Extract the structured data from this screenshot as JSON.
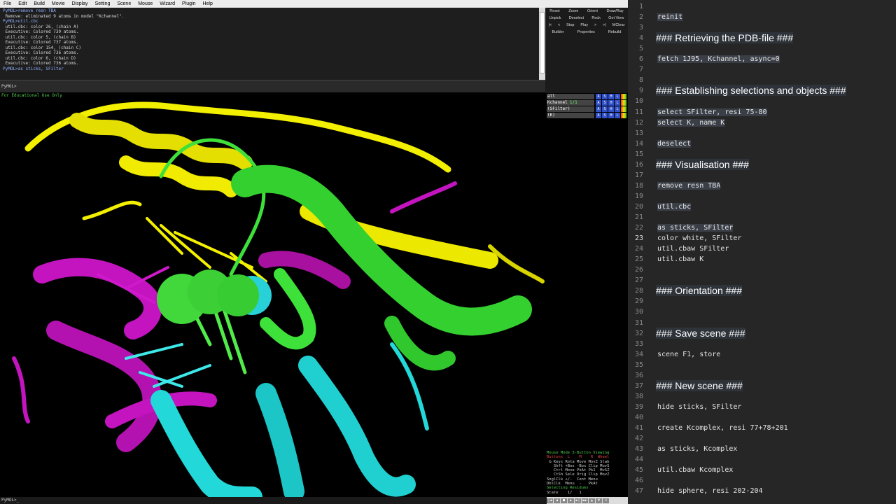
{
  "menu": [
    "File",
    "Edit",
    "Build",
    "Movie",
    "Display",
    "Setting",
    "Scene",
    "Mouse",
    "Wizard",
    "Plugin",
    "Help"
  ],
  "console": {
    "lines": [
      {
        "t": "PyMOL>remove resn TBA",
        "cmd": true
      },
      {
        "t": " Remove: eliminated 9 atoms in model \"Kchannel\".",
        "cmd": false
      },
      {
        "t": "PyMOL>util.cbc",
        "cmd": true
      },
      {
        "t": " util.cbc: color 26, (chain A)",
        "cmd": false
      },
      {
        "t": " Executive: Colored 739 atoms.",
        "cmd": false
      },
      {
        "t": " util.cbc: color 5, (chain B)",
        "cmd": false
      },
      {
        "t": " Executive: Colored 737 atoms.",
        "cmd": false
      },
      {
        "t": " util.cbc: color 154, (chain C)",
        "cmd": false
      },
      {
        "t": " Executive: Colored 736 atoms.",
        "cmd": false
      },
      {
        "t": " util.cbc: color 6, (chain D)",
        "cmd": false
      },
      {
        "t": " Executive: Colored 736 atoms.",
        "cmd": false
      },
      {
        "t": "PyMOL>as sticks, SFilter",
        "cmd": true
      }
    ],
    "prompt": "PyMOL>"
  },
  "buttons": {
    "row1": [
      "Reset",
      "Zoom",
      "Orient",
      "Draw/Ray"
    ],
    "row2": [
      "Unpick",
      "Deselect",
      "Rock",
      "Get View"
    ],
    "row3": [
      "|<",
      "<",
      "Stop",
      "Play",
      ">",
      ">|",
      "MClear"
    ],
    "row4": [
      "Builder",
      "Properties",
      "Rebuild"
    ]
  },
  "viewer": {
    "watermark": "For Educational Use Only"
  },
  "objects": [
    {
      "name": "all",
      "count": ""
    },
    {
      "name": "Kchannel",
      "count": "1/1"
    },
    {
      "name": "(SFilter)",
      "count": ""
    },
    {
      "name": "(K)",
      "count": ""
    }
  ],
  "object_actions": [
    "A",
    "S",
    "H",
    "L"
  ],
  "mouse_panel": [
    "Mouse Mode 3-Button Viewing",
    "Buttons  L    M    R  Wheel",
    " & Keys Rota Move MovZ Slab",
    "   Shft +Box -Box Clip MovS",
    "   Ctrl Move PkAt Pk1  MvSZ",
    "   CtSh Sele Orig Clip MovZ",
    "SnglClk +/-  Cent Menu",
    "DblClk  Menu  -   PkAt",
    "Selecting Residues",
    "State    1/   1"
  ],
  "bottom_prompt": "PyMOL>_",
  "editor": {
    "current_line": 23,
    "lines": [
      {
        "n": 1,
        "text": "",
        "kind": "code"
      },
      {
        "n": 2,
        "text": "reinit",
        "kind": "code"
      },
      {
        "n": 3,
        "text": "",
        "kind": "code"
      },
      {
        "n": 4,
        "text": "### Retrieving the PDB-file ###",
        "kind": "heading"
      },
      {
        "n": 5,
        "text": "",
        "kind": "code"
      },
      {
        "n": 6,
        "text": "fetch 1J95, Kchannel, async=0",
        "kind": "code"
      },
      {
        "n": 7,
        "text": "",
        "kind": "code"
      },
      {
        "n": 8,
        "text": "",
        "kind": "code"
      },
      {
        "n": 9,
        "text": "### Establishing selections and objects ###",
        "kind": "heading"
      },
      {
        "n": 10,
        "text": "",
        "kind": "code"
      },
      {
        "n": 11,
        "text": "select SFilter, resi 75-80",
        "kind": "code"
      },
      {
        "n": 12,
        "text": "select K, name K",
        "kind": "code"
      },
      {
        "n": 13,
        "text": "",
        "kind": "code"
      },
      {
        "n": 14,
        "text": "deselect",
        "kind": "code"
      },
      {
        "n": 15,
        "text": "",
        "kind": "code"
      },
      {
        "n": 16,
        "text": "### Visualisation ###",
        "kind": "heading"
      },
      {
        "n": 17,
        "text": "",
        "kind": "code"
      },
      {
        "n": 18,
        "text": "remove resn TBA",
        "kind": "code"
      },
      {
        "n": 19,
        "text": "",
        "kind": "code"
      },
      {
        "n": 20,
        "text": "util.cbc",
        "kind": "code"
      },
      {
        "n": 21,
        "text": "",
        "kind": "code"
      },
      {
        "n": 22,
        "text": "as sticks, SFilter",
        "kind": "code"
      },
      {
        "n": 23,
        "text": "color white, SFilter",
        "kind": "plain"
      },
      {
        "n": 24,
        "text": "util.cbaw SFilter",
        "kind": "plain"
      },
      {
        "n": 25,
        "text": "util.cbaw K",
        "kind": "plain"
      },
      {
        "n": 26,
        "text": "",
        "kind": "plain"
      },
      {
        "n": 27,
        "text": "",
        "kind": "plain"
      },
      {
        "n": 28,
        "text": "### Orientation ###",
        "kind": "heading"
      },
      {
        "n": 29,
        "text": "",
        "kind": "plain"
      },
      {
        "n": 30,
        "text": "",
        "kind": "plain"
      },
      {
        "n": 31,
        "text": "",
        "kind": "plain"
      },
      {
        "n": 32,
        "text": "### Save scene ###",
        "kind": "heading"
      },
      {
        "n": 33,
        "text": "",
        "kind": "plain"
      },
      {
        "n": 34,
        "text": "scene F1, store",
        "kind": "plain"
      },
      {
        "n": 35,
        "text": "",
        "kind": "plain"
      },
      {
        "n": 36,
        "text": "",
        "kind": "plain"
      },
      {
        "n": 37,
        "text": "### New scene ###",
        "kind": "heading"
      },
      {
        "n": 38,
        "text": "",
        "kind": "plain"
      },
      {
        "n": 39,
        "text": "hide sticks, SFilter",
        "kind": "plain"
      },
      {
        "n": 40,
        "text": "",
        "kind": "plain"
      },
      {
        "n": 41,
        "text": "create Kcomplex, resi 77+78+201",
        "kind": "plain"
      },
      {
        "n": 42,
        "text": "",
        "kind": "plain"
      },
      {
        "n": 43,
        "text": "as sticks, Kcomplex",
        "kind": "plain"
      },
      {
        "n": 44,
        "text": "",
        "kind": "plain"
      },
      {
        "n": 45,
        "text": "util.cbaw Kcomplex",
        "kind": "plain"
      },
      {
        "n": 46,
        "text": "",
        "kind": "plain"
      },
      {
        "n": 47,
        "text": "hide sphere, resi 202-204",
        "kind": "plain"
      }
    ]
  },
  "colors": {
    "yellow": "#f2ef00",
    "green": "#3ee03a",
    "magenta": "#c414c0",
    "cyan": "#22d8d8"
  }
}
